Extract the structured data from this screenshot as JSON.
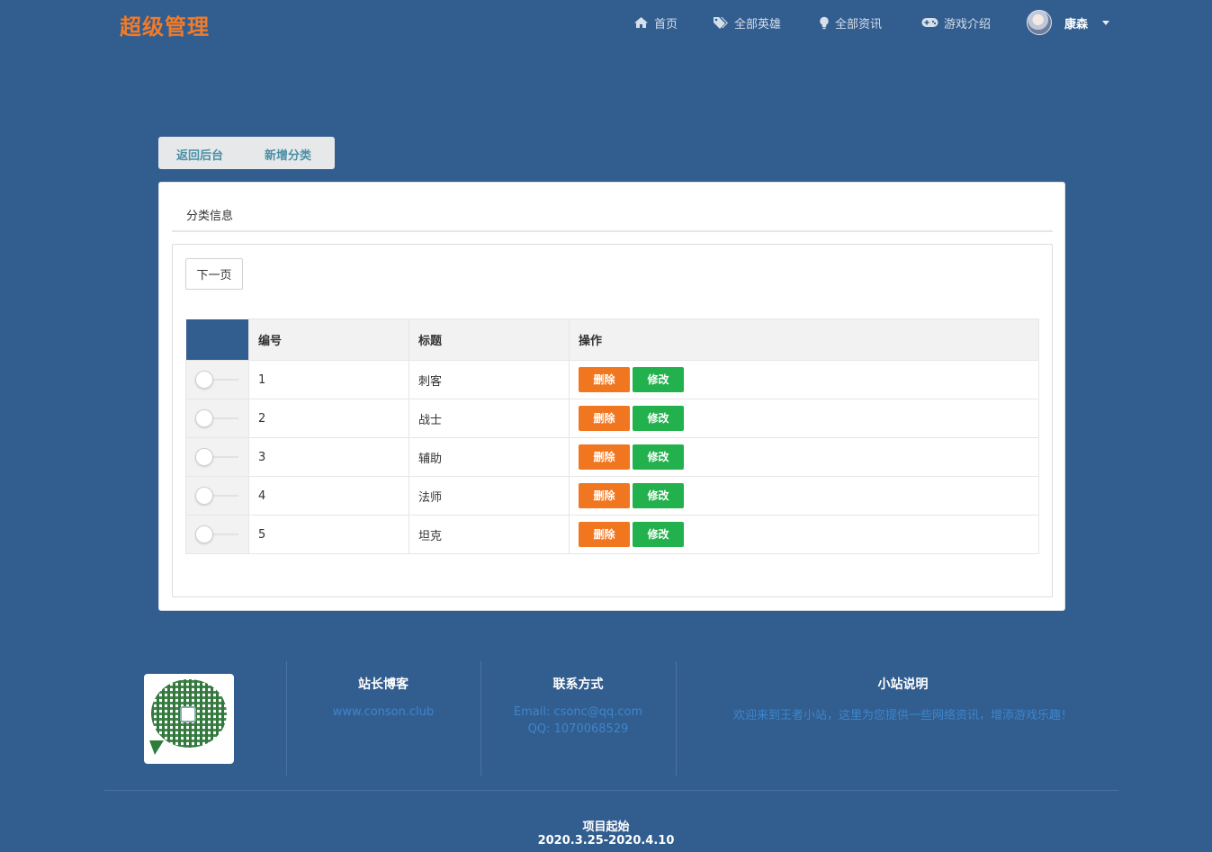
{
  "brand": "超级管理",
  "nav": {
    "home": "首页",
    "heroes": "全部英雄",
    "news": "全部资讯",
    "games": "游戏介绍",
    "user": "康森"
  },
  "tabs": {
    "back": "返回后台",
    "add": "新增分类"
  },
  "card": {
    "title": "分类信息",
    "next_page": "下一页"
  },
  "table": {
    "headers": [
      "编号",
      "标题",
      "操作"
    ],
    "delete_label": "删除",
    "edit_label": "修改",
    "rows": [
      {
        "id": "1",
        "title": "刺客"
      },
      {
        "id": "2",
        "title": "战士"
      },
      {
        "id": "3",
        "title": "辅助"
      },
      {
        "id": "4",
        "title": "法师"
      },
      {
        "id": "5",
        "title": "坦克"
      }
    ]
  },
  "footer": {
    "blog_heading": "站长博客",
    "blog_link": "www.conson.club",
    "contact_heading": "联系方式",
    "email": "Email: csonc@qq.com",
    "qq": "QQ: 1070068529",
    "about_heading": "小站说明",
    "about_text": "欢迎来到王者小站，这里为您提供一些网络资讯，增添游戏乐趣！",
    "project_label": "项目起始",
    "project_dates": "2020.3.25-2020.4.10"
  },
  "colors": {
    "background": "#325d8f",
    "brand": "#f07b2a",
    "delete": "#f07620",
    "edit": "#22b14c",
    "link": "#3c86cc"
  }
}
